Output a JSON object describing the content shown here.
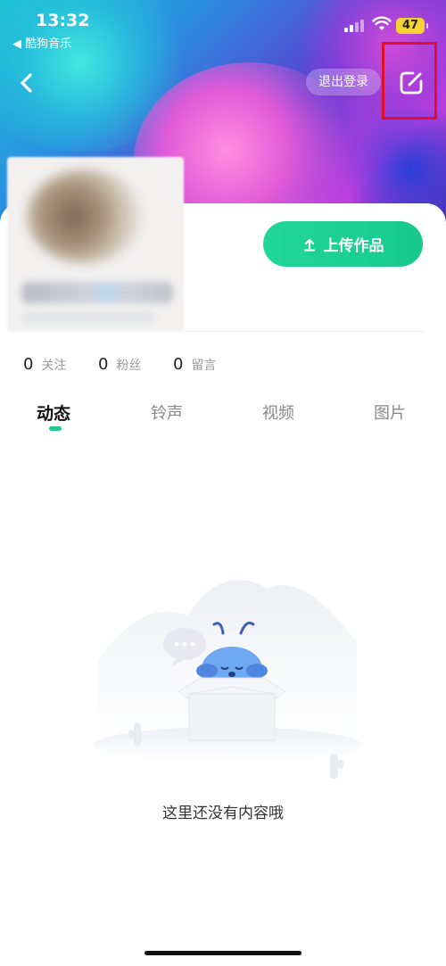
{
  "status_bar": {
    "time": "13:32",
    "back_app": "◀ 酷狗音乐",
    "battery": "47"
  },
  "nav": {
    "logout_label": "退出登录"
  },
  "profile": {
    "upload_label": "上传作品"
  },
  "stats": [
    {
      "value": "0",
      "label": "关注"
    },
    {
      "value": "0",
      "label": "粉丝"
    },
    {
      "value": "0",
      "label": "留言"
    }
  ],
  "tabs": [
    {
      "label": "动态",
      "active": true
    },
    {
      "label": "铃声",
      "active": false
    },
    {
      "label": "视频",
      "active": false
    },
    {
      "label": "图片",
      "active": false
    }
  ],
  "empty_state": {
    "message": "这里还没有内容哦"
  },
  "colors": {
    "accent_green": "#20cc8f",
    "highlight_red": "#e0102a"
  },
  "icons": [
    "back-icon",
    "edit-icon",
    "upload-icon",
    "signal-icon",
    "wifi-icon",
    "battery-icon"
  ]
}
